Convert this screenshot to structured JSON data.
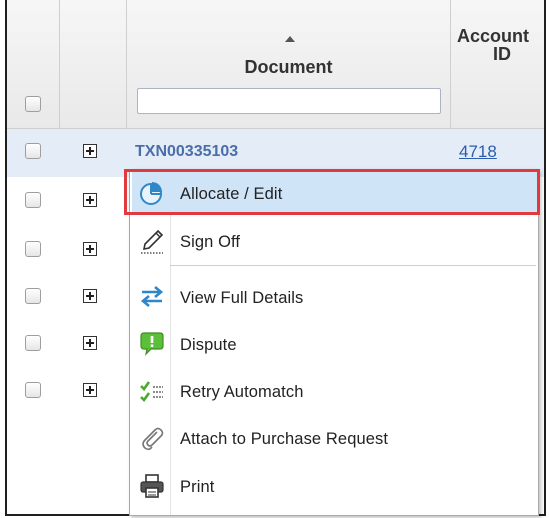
{
  "table": {
    "columns": {
      "document": "Document",
      "account_id_line1": "Account",
      "account_id_line2": "ID"
    },
    "filter_value": "",
    "rows": [
      {
        "document": "TXN00335103",
        "account_id": "4718"
      }
    ],
    "row_count": 6
  },
  "context_menu": {
    "items": [
      {
        "label": "Allocate / Edit",
        "icon": "pie-chart-icon"
      },
      {
        "label": "Sign Off",
        "icon": "pen-signature-icon"
      },
      {
        "label": "View Full Details",
        "icon": "swap-arrows-icon"
      },
      {
        "label": "Dispute",
        "icon": "speech-exclamation-icon"
      },
      {
        "label": "Retry Automatch",
        "icon": "checklist-icon"
      },
      {
        "label": "Attach to Purchase Request",
        "icon": "paperclip-icon"
      },
      {
        "label": "Print",
        "icon": "printer-icon"
      }
    ]
  },
  "colors": {
    "highlight_border": "#e0393e",
    "selected_item_bg": "#cfe4f7",
    "link": "#2a5db0",
    "doc_id": "#4a6ea9"
  }
}
